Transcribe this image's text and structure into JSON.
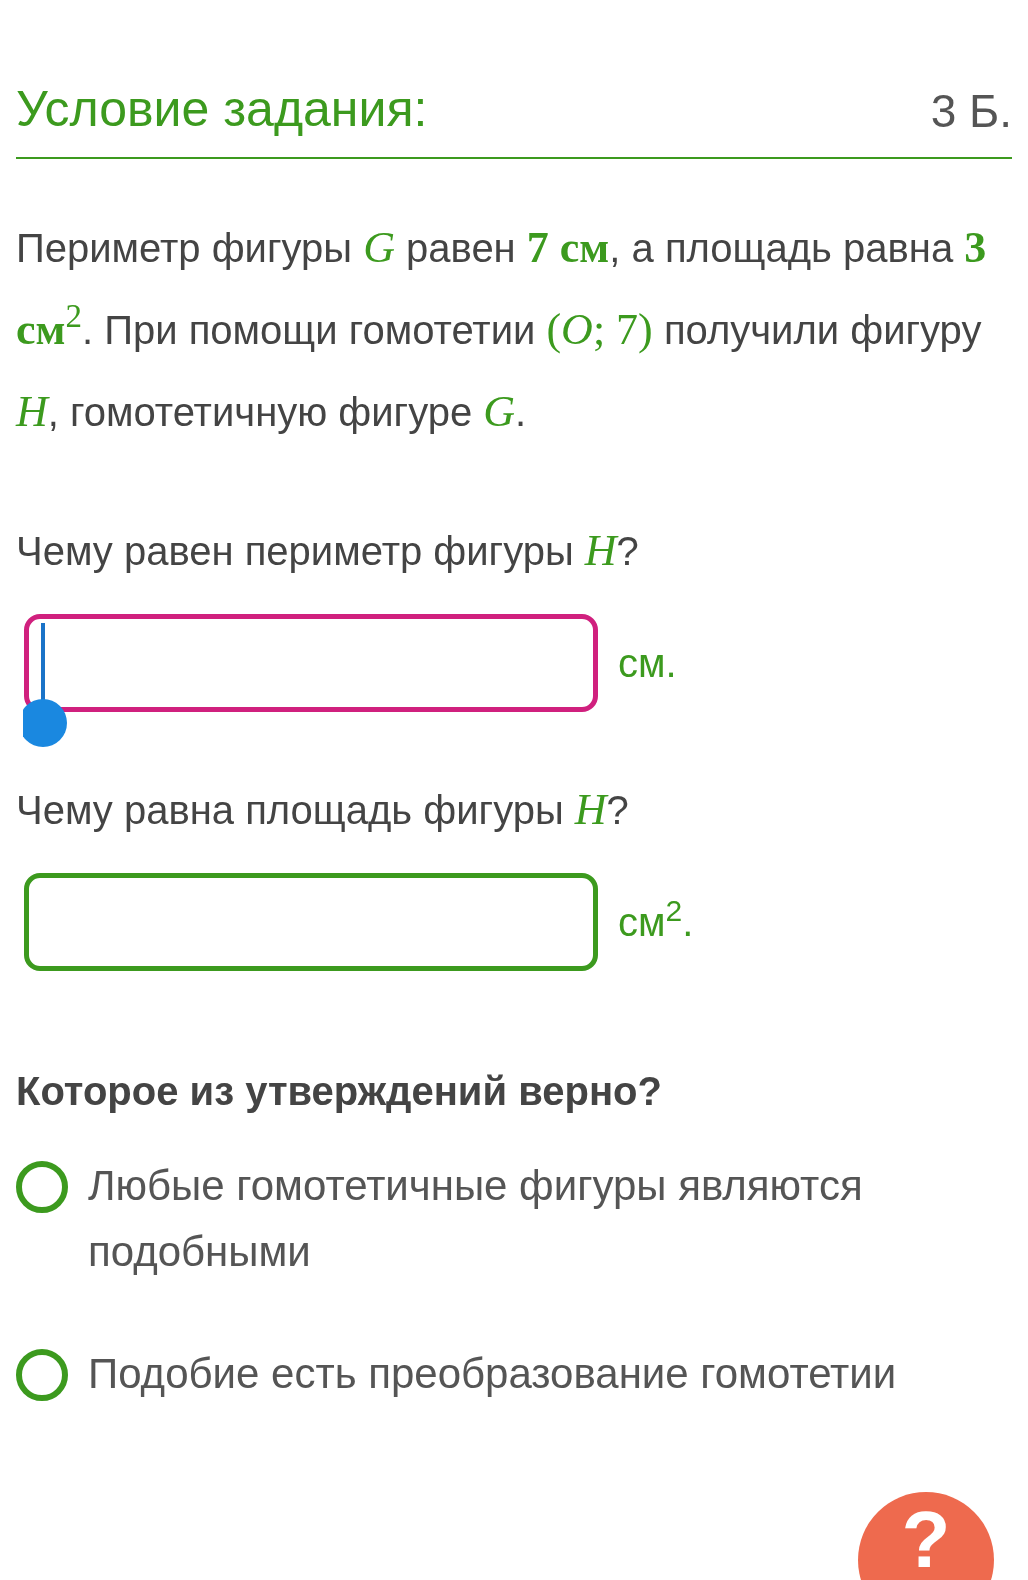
{
  "header": {
    "title": "Условие задания:",
    "points": "3 Б."
  },
  "problem": [
    {
      "kind": "text",
      "text": "Периметр фигуры "
    },
    {
      "kind": "math",
      "text": "*G*"
    },
    {
      "kind": "text",
      "text": " равен "
    },
    {
      "kind": "math",
      "text": "**7 см**"
    },
    {
      "kind": "text",
      "text": ", а площадь равна "
    },
    {
      "kind": "math",
      "text": "**3 см**$^{2}$"
    },
    {
      "kind": "text",
      "text": ". При помощи гомотетии "
    },
    {
      "kind": "math",
      "text": "(*O*; 7)"
    },
    {
      "kind": "text",
      "text": " получили фигуру "
    },
    {
      "kind": "math",
      "text": "*H*"
    },
    {
      "kind": "text",
      "text": ", гомотетичную фигуре "
    },
    {
      "kind": "math",
      "text": "*G*"
    },
    {
      "kind": "text",
      "text": "."
    }
  ],
  "questions": [
    {
      "prompt": [
        {
          "kind": "text",
          "text": "Чему равен периметр фигуры "
        },
        {
          "kind": "math",
          "text": "*H*"
        },
        {
          "kind": "text",
          "text": "?"
        }
      ],
      "focused": true,
      "unit": "см."
    },
    {
      "prompt": [
        {
          "kind": "text",
          "text": "Чему равна площадь фигуры "
        },
        {
          "kind": "math",
          "text": "*H*"
        },
        {
          "kind": "text",
          "text": "?"
        }
      ],
      "focused": false,
      "unit": "см$^{2}$."
    }
  ],
  "choice": {
    "question": "Которое из утверждений верно?",
    "options": [
      {
        "label": "Любые гомотетичные фигуры являются подобными",
        "selected": false
      },
      {
        "label": "Подобие есть преобразование гомотетии",
        "selected": false
      }
    ]
  },
  "help_button": {
    "label": "?"
  }
}
